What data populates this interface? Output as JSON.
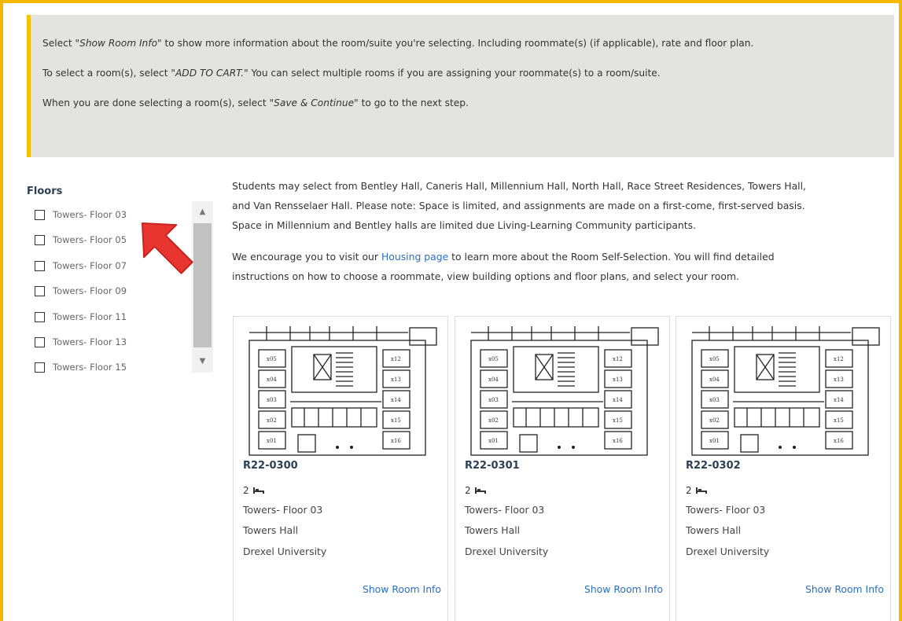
{
  "instructions": {
    "line1": {
      "pre": "Select \"",
      "em": "Show Room Info",
      "post": "\" to show more information about the room/suite you're selecting. Including roommate(s) (if applicable), rate and floor plan."
    },
    "line2": {
      "pre": "To select a room(s), select \"",
      "em": "ADD TO CART.",
      "post": "\" You can select multiple rooms if you are assigning your roommate(s) to a room/suite."
    },
    "line3": {
      "pre": "When you are done selecting a room(s), select \"",
      "em": "Save & Continue",
      "post": "\" to go to the next step."
    }
  },
  "floors": {
    "title": "Floors",
    "items": [
      {
        "label": "Towers- Floor 03",
        "checked": false
      },
      {
        "label": "Towers- Floor 05",
        "checked": false
      },
      {
        "label": "Towers- Floor 07",
        "checked": false
      },
      {
        "label": "Towers- Floor 09",
        "checked": false
      },
      {
        "label": "Towers- Floor 11",
        "checked": false
      },
      {
        "label": "Towers- Floor 13",
        "checked": false
      },
      {
        "label": "Towers- Floor 15",
        "checked": false
      }
    ]
  },
  "intro": {
    "p1_l1": "Students may select from Bentley Hall, Caneris Hall, Millennium Hall, North Hall, Race Street Residences, Towers Hall,",
    "p1_l2": "and Van Rensselaer Hall. Please note: Space is limited, and assignments are made on a first-come, first-served basis.",
    "p1_l3": "Space in Millennium and Bentley halls are limited due Living-Learning Community participants.",
    "p2_pre": "We encourage you to visit our ",
    "p2_link": "Housing page",
    "p2_post": " to learn more about the Room Self-Selection. You will find detailed",
    "p2_l2": "instructions on how to choose a roommate, view building options and floor plans, and select your room."
  },
  "rooms": [
    {
      "id": "R22-0300",
      "beds": "2",
      "floor": "Towers- Floor 03",
      "hall": "Towers Hall",
      "school": "Drexel University",
      "action": "Show Room Info"
    },
    {
      "id": "R22-0301",
      "beds": "2",
      "floor": "Towers- Floor 03",
      "hall": "Towers Hall",
      "school": "Drexel University",
      "action": "Show Room Info"
    },
    {
      "id": "R22-0302",
      "beds": "2",
      "floor": "Towers- Floor 03",
      "hall": "Towers Hall",
      "school": "Drexel University",
      "action": "Show Room Info"
    }
  ],
  "floor_plan_labels": [
    "x05",
    "x04",
    "x03",
    "x02",
    "x01",
    "x12",
    "x13",
    "x14",
    "x15",
    "x16"
  ],
  "icons": {
    "bed": "bed-icon",
    "pointer": "red-pointer-arrow-icon",
    "scroll_up": "scroll-up-arrow-icon",
    "scroll_down": "scroll-down-arrow-icon"
  },
  "colors": {
    "frame": "#f5b800",
    "notice_bg": "#e3e3e1",
    "notice_accent": "#f5c200",
    "link": "#2b6fc2",
    "heading": "#2b3f55",
    "pointer": "#e8352f"
  }
}
